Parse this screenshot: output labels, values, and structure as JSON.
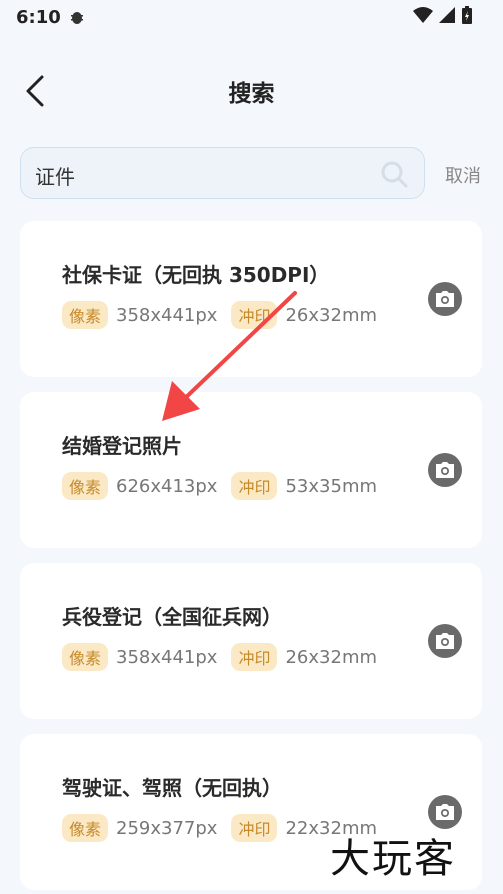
{
  "status_bar": {
    "time": "6:10"
  },
  "header": {
    "title": "搜索"
  },
  "search": {
    "value": "证件",
    "cancel_label": "取消"
  },
  "results": [
    {
      "name": "社保卡证（无回执 350DPI）",
      "pixel_tag": "像素",
      "pixels": "358x441px",
      "print_tag": "冲印",
      "print": "26x32mm"
    },
    {
      "name": "结婚登记照片",
      "pixel_tag": "像素",
      "pixels": "626x413px",
      "print_tag": "冲印",
      "print": "53x35mm"
    },
    {
      "name": "兵役登记（全国征兵网）",
      "pixel_tag": "像素",
      "pixels": "358x441px",
      "print_tag": "冲印",
      "print": "26x32mm"
    },
    {
      "name": "驾驶证、驾照（无回执）",
      "pixel_tag": "像素",
      "pixels": "259x377px",
      "print_tag": "冲印",
      "print": "22x32mm"
    }
  ],
  "watermark": "大玩客",
  "colors": {
    "background": "#f4f7fb",
    "tag_bg": "#fbe9c6",
    "tag_text": "#c68a2a",
    "arrow": "#f24545"
  }
}
